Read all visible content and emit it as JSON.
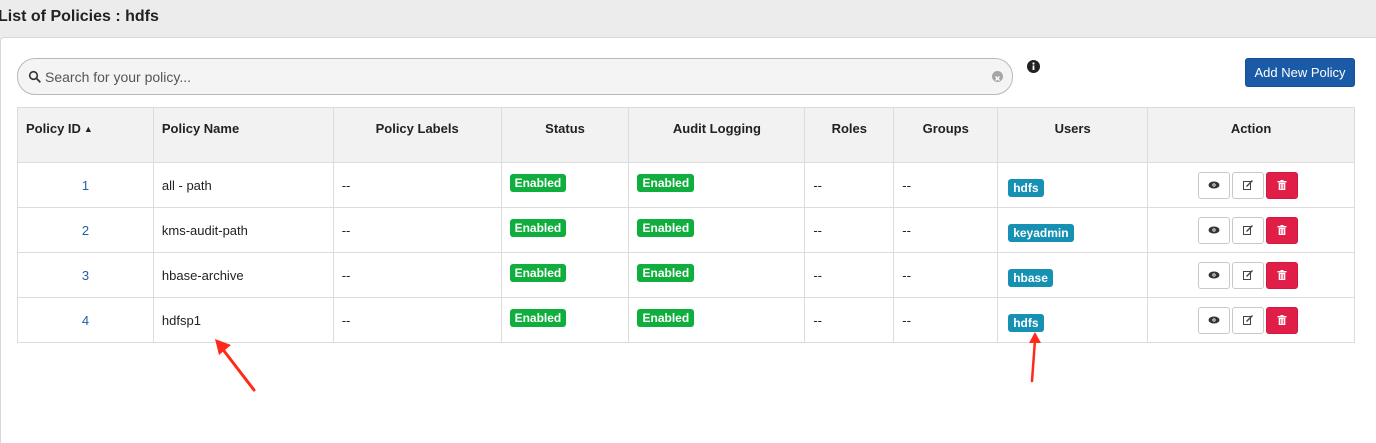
{
  "page": {
    "title": "List of Policies : hdfs"
  },
  "search": {
    "placeholder": "Search for your policy...",
    "value": ""
  },
  "toolbar": {
    "add_label": "Add New Policy"
  },
  "table": {
    "headers": {
      "policy_id": "Policy ID",
      "policy_name": "Policy Name",
      "policy_labels": "Policy Labels",
      "status": "Status",
      "audit_logging": "Audit Logging",
      "roles": "Roles",
      "groups": "Groups",
      "users": "Users",
      "action": "Action"
    },
    "rows": [
      {
        "id": "1",
        "name": "all - path",
        "labels": "--",
        "status": "Enabled",
        "audit": "Enabled",
        "roles": "--",
        "groups": "--",
        "user": "hdfs"
      },
      {
        "id": "2",
        "name": "kms-audit-path",
        "labels": "--",
        "status": "Enabled",
        "audit": "Enabled",
        "roles": "--",
        "groups": "--",
        "user": "keyadmin"
      },
      {
        "id": "3",
        "name": "hbase-archive",
        "labels": "--",
        "status": "Enabled",
        "audit": "Enabled",
        "roles": "--",
        "groups": "--",
        "user": "hbase"
      },
      {
        "id": "4",
        "name": "hdfsp1",
        "labels": "--",
        "status": "Enabled",
        "audit": "Enabled",
        "roles": "--",
        "groups": "--",
        "user": "hdfs"
      }
    ]
  },
  "colors": {
    "primary": "#1a5aa6",
    "enabled": "#0fae3d",
    "user_badge": "#1690b3",
    "delete": "#e01e48",
    "annotation": "#ff2a1a"
  },
  "icons": {
    "search": "search-icon",
    "clear": "clear-icon",
    "info": "info-icon",
    "sort": "sort-asc-icon",
    "view": "eye-icon",
    "edit": "edit-icon",
    "delete": "trash-icon"
  }
}
